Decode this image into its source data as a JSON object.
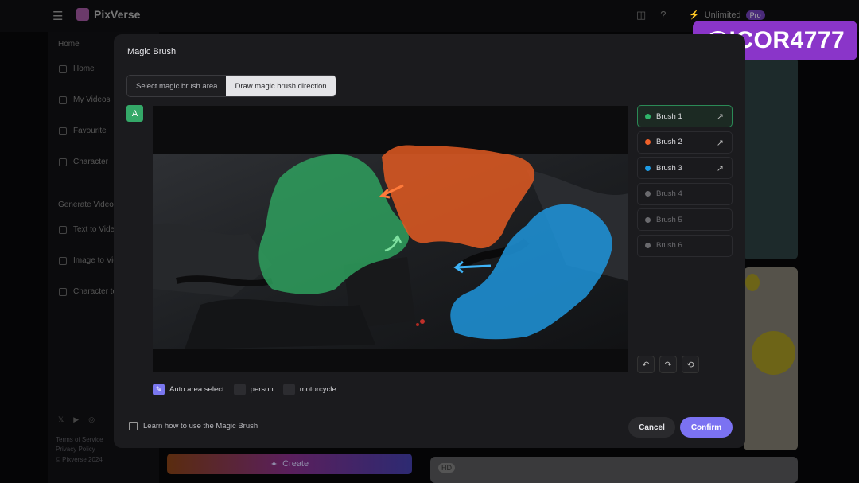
{
  "app": {
    "brand": "PixVerse",
    "unlimited": "Unlimited",
    "pro": "Pro"
  },
  "sidebar": {
    "items": [
      "Home",
      "My Videos",
      "Favourite",
      "Character"
    ],
    "section": "Generate Video",
    "gen_items": [
      "Text to Video",
      "Image to Video",
      "Character to Video"
    ],
    "social": [
      "𝕏",
      "▶",
      "◎"
    ],
    "footer": [
      "Terms of Service",
      "Privacy Policy",
      "© Pixverse 2024"
    ]
  },
  "background": {
    "create_label": "Create",
    "hd_badge": "HD"
  },
  "watermark": "@ICOR4777",
  "modal": {
    "title": "Magic Brush",
    "tabs": [
      "Select magic brush area",
      "Draw magic brush direction"
    ],
    "active_tab": 1,
    "area_badge": "A",
    "brushes": [
      {
        "label": "Brush 1",
        "color": "#2fb56a",
        "used": true,
        "selected": true
      },
      {
        "label": "Brush 2",
        "color": "#f0612a",
        "used": true,
        "selected": false
      },
      {
        "label": "Brush 3",
        "color": "#1e9be4",
        "used": true,
        "selected": false
      },
      {
        "label": "Brush 4",
        "color": "#6a6a6e",
        "used": false,
        "selected": false
      },
      {
        "label": "Brush 5",
        "color": "#6a6a6e",
        "used": false,
        "selected": false
      },
      {
        "label": "Brush 6",
        "color": "#6a6a6e",
        "used": false,
        "selected": false
      }
    ],
    "checkboxes": [
      {
        "label": "Auto area select",
        "checked": true
      },
      {
        "label": "person",
        "checked": false
      },
      {
        "label": "motorcycle",
        "checked": false
      }
    ],
    "learn_link": "Learn how to use the Magic Brush",
    "cancel": "Cancel",
    "confirm": "Confirm"
  }
}
